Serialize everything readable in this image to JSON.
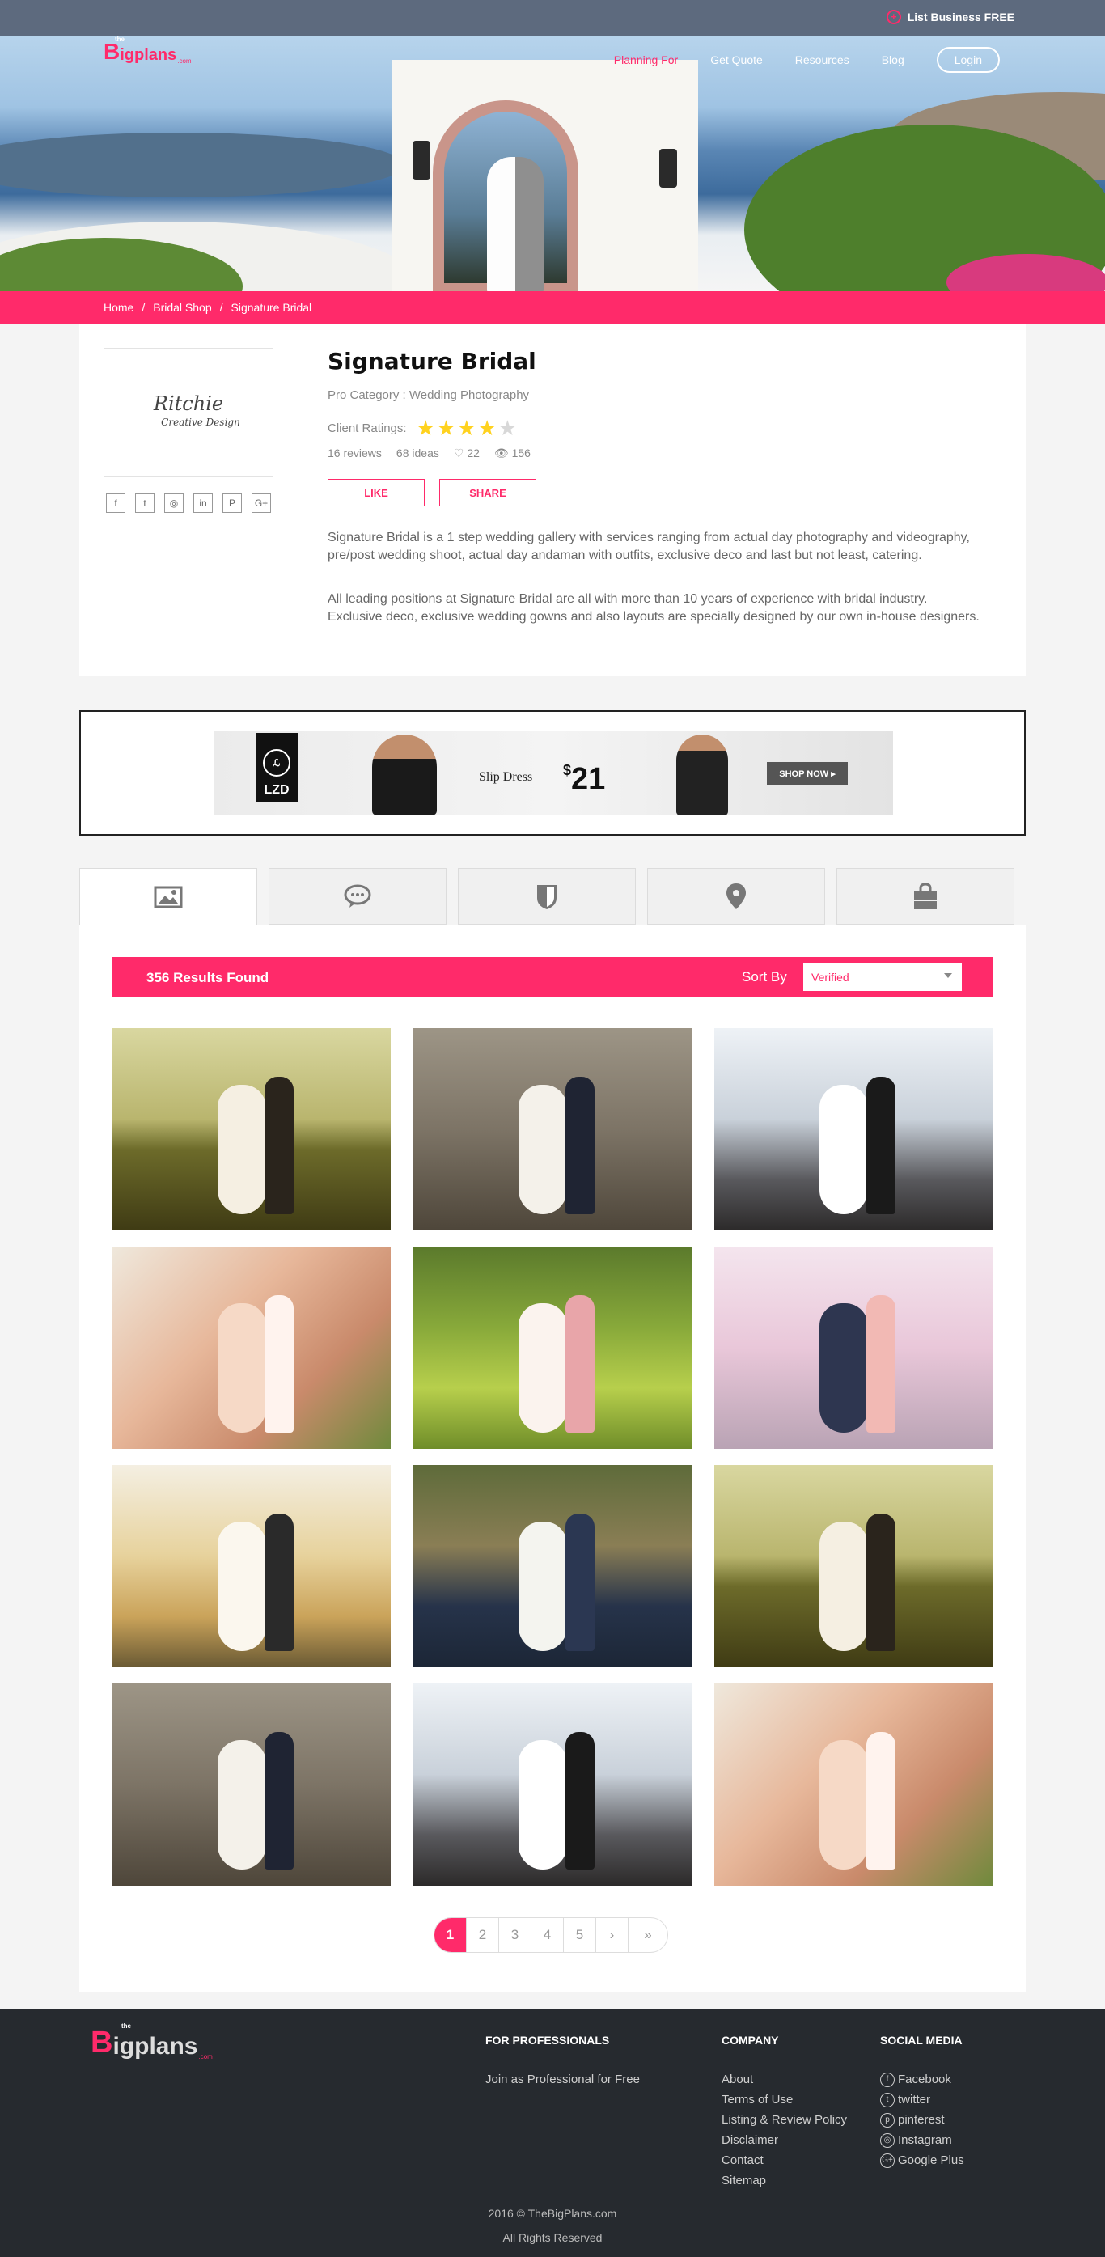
{
  "topbar": {
    "list_business": "List Business FREE"
  },
  "brand": {
    "the": "the",
    "b": "B",
    "rest": "igplans",
    "com": ".com"
  },
  "nav": {
    "items": [
      "Planning For",
      "Get Quote",
      "Resources",
      "Blog"
    ],
    "login": "Login"
  },
  "breadcrumb": {
    "items": [
      "Home",
      "/",
      "Bridal Shop",
      "/",
      "Signature Bridal"
    ]
  },
  "profile": {
    "logo_line1": "Ritchie",
    "logo_line2": "Creative Design",
    "title": "Signature Bridal",
    "pro_category": "Pro Category : Wedding Photography",
    "ratings_label": "Client Ratings:",
    "rating_value": 4,
    "rating_max": 5,
    "reviews": "16 reviews",
    "ideas": "68 ideas",
    "likes": "22",
    "views": "156",
    "like_label": "LIKE",
    "share_label": "SHARE",
    "description_1": "Signature Bridal is a 1 step wedding gallery with services ranging from actual day photography and videography, pre/post wedding shoot, actual day andaman with outfits, exclusive deco and last but not least, catering.",
    "description_2": "All leading positions at Signature Bridal are all with more than 10 years of experience with bridal industry. Exclusive deco, exclusive wedding gowns and also layouts are specially designed by our own in-house designers.",
    "socials": [
      "f",
      "t",
      "◎",
      "in",
      "P",
      "G+"
    ]
  },
  "ad": {
    "brand": "LZD",
    "product": "Slip Dress",
    "currency": "$",
    "price": "21",
    "cta": "SHOP NOW ▸"
  },
  "tabs": [
    "gallery-icon",
    "reviews-icon",
    "badge-icon",
    "location-icon",
    "shop-icon"
  ],
  "gallery": {
    "results": "356 Results Found",
    "sort_label": "Sort By",
    "sort_value": "Verified",
    "photos": [
      "bride-groom-field",
      "couple-ruins-steps",
      "couple-silhouette-veil",
      "hands-ring-blossom",
      "couple-grass-laughing",
      "couple-pink-blossom",
      "wedding-party-signs",
      "bridesmaids-bouquets",
      "bride-groom-field",
      "couple-ruins-steps",
      "couple-silhouette-veil",
      "hands-ring-blossom"
    ]
  },
  "pagination": {
    "pages": [
      "1",
      "2",
      "3",
      "4",
      "5"
    ],
    "next": "›",
    "last": "»",
    "current": 1
  },
  "footer": {
    "professionals_title": "FOR PROFESSIONALS",
    "professionals_link": "Join as Professional for Free",
    "company_title": "COMPANY",
    "company_links": [
      "About",
      "Terms of Use",
      "Listing & Review Policy",
      "Disclaimer",
      "Contact",
      "Sitemap"
    ],
    "social_title": "SOCIAL MEDIA",
    "social_links": [
      "Facebook",
      "twitter",
      "pinterest",
      "Instagram",
      "Google Plus"
    ],
    "social_icons": [
      "f",
      "t",
      "p",
      "◎",
      "G+"
    ],
    "copyright": "2016 © TheBigPlans.com",
    "rights": "All Rights Reserved"
  },
  "colors": {
    "accent": "#ff2a6a",
    "footer_bg": "#262a2f",
    "star": "#ffd21f"
  }
}
